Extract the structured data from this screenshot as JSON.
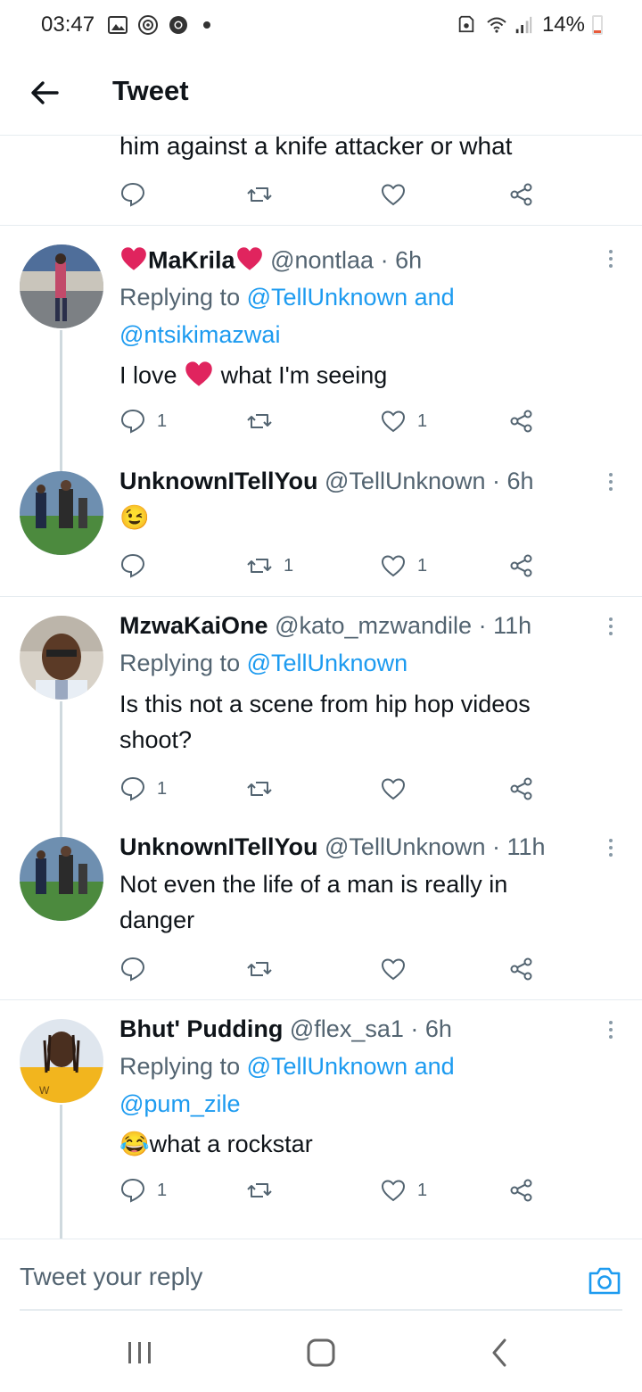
{
  "status_bar": {
    "time": "03:47",
    "battery": "14%",
    "icons": [
      "gallery-icon",
      "sync-icon",
      "chrome-icon",
      "dot-icon",
      "save-icon",
      "wifi-icon",
      "signal-icon",
      "battery-icon"
    ],
    "battery_level": 0.14
  },
  "header": {
    "title": "Tweet"
  },
  "partial_tweet": {
    "text": "him against a knife attacker or what"
  },
  "tweets": [
    {
      "name": "MaKrila",
      "handle": "@nontlaa",
      "time": "6h",
      "replying_prefix": "Replying to",
      "replying_line1": "@TellUnknown and",
      "replying_line2": "@ntsikimazwai",
      "text_before": "I love",
      "text_after": "what I'm seeing",
      "reply_count": "1",
      "retweet_count": "",
      "like_count": "1"
    },
    {
      "name": "UnknownITellYou",
      "handle": "@TellUnknown",
      "time": "6h",
      "text": "😉",
      "reply_count": "",
      "retweet_count": "1",
      "like_count": "1"
    },
    {
      "name": "MzwaKaiOne",
      "handle": "@kato_mzwandile",
      "time": "11h",
      "replying_prefix": "Replying to",
      "replying_line1": "@TellUnknown",
      "text_line1": "Is this not a scene from hip hop videos",
      "text_line2": "shoot?",
      "reply_count": "1",
      "retweet_count": "",
      "like_count": ""
    },
    {
      "name": "UnknownITellYou",
      "handle": "@TellUnknown",
      "time": "11h",
      "text_line1": "Not even the life of a man is really in",
      "text_line2": "danger",
      "reply_count": "",
      "retweet_count": "",
      "like_count": ""
    },
    {
      "name": "Bhut' Pudding",
      "handle": "@flex_sa1",
      "time": "6h",
      "replying_prefix": "Replying to",
      "replying_line1": "@TellUnknown and",
      "replying_line2": "@pum_zile",
      "text": "😂what a rockstar",
      "reply_count": "1",
      "retweet_count": "",
      "like_count": "1"
    }
  ],
  "reply_bar": {
    "placeholder": "Tweet your reply"
  },
  "colors": {
    "accent": "#1d9bf0",
    "muted": "#536471",
    "text": "#0f1419",
    "heart": "#e0245e"
  }
}
